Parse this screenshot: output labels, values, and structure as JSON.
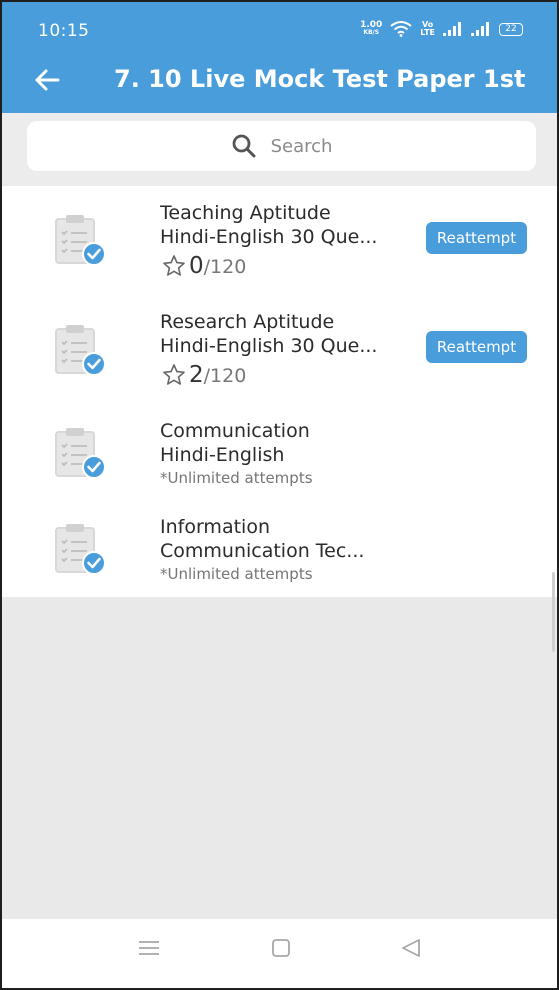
{
  "status_bar": {
    "time": "10:15",
    "net_speed_value": "1.00",
    "net_speed_unit": "KB/S",
    "volte_top": "Vo",
    "volte_bottom": "LTE",
    "battery_level": "22",
    "icons": [
      "wifi-icon",
      "signal-icon",
      "signal-icon",
      "battery-icon"
    ]
  },
  "toolbar": {
    "back_icon": "arrow-left-icon",
    "title": "7. 10 Live Mock Test Paper 1st"
  },
  "search": {
    "placeholder": "Search",
    "icon": "search-icon"
  },
  "tests": [
    {
      "title_line1": "Teaching Aptitude",
      "title_line2": "Hindi-English 30 Que...",
      "score": "0",
      "total": "/120",
      "action_label": "Reattempt"
    },
    {
      "title_line1": "Research Aptitude",
      "title_line2": "Hindi-English 30 Que...",
      "score": "2",
      "total": "/120",
      "action_label": "Reattempt"
    },
    {
      "title_line1": "Communication",
      "title_line2": "Hindi-English",
      "note": "*Unlimited attempts"
    },
    {
      "title_line1": "Information",
      "title_line2": "Communication Tec...",
      "note": "*Unlimited attempts"
    }
  ],
  "nav": {
    "icons": [
      "menu-icon",
      "home-square-icon",
      "back-triangle-icon"
    ]
  },
  "colors": {
    "accent": "#4a9ddb",
    "background": "#e9e9e9",
    "card": "#ffffff"
  }
}
